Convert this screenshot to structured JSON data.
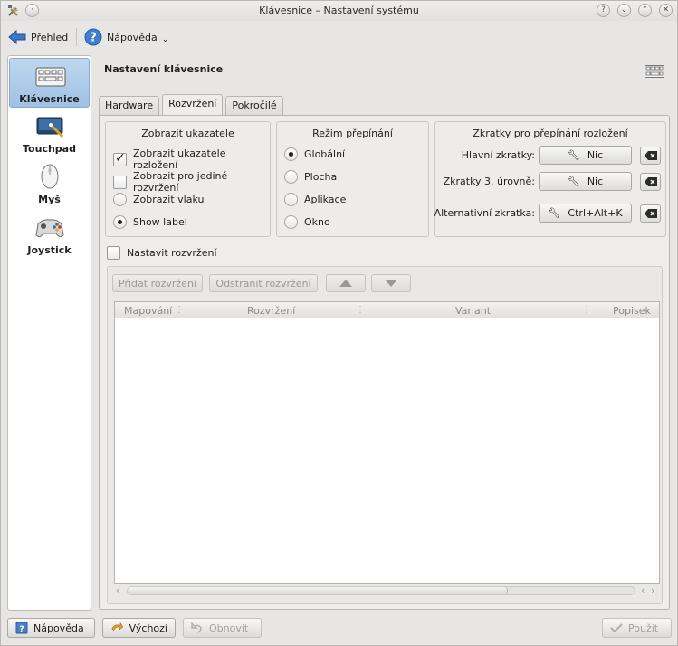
{
  "window": {
    "title": "Klávesnice – Nastavení systému",
    "button_help": "?",
    "button_min": "⌄",
    "button_max": "⌃",
    "button_close": "✕"
  },
  "toolbar": {
    "overview": "Přehled",
    "help": "Nápověda"
  },
  "sidebar": {
    "items": [
      {
        "label": "Klávesnice",
        "icon": "keyboard-icon"
      },
      {
        "label": "Touchpad",
        "icon": "touchpad-icon"
      },
      {
        "label": "Myš",
        "icon": "mouse-icon"
      },
      {
        "label": "Joystick",
        "icon": "joystick-icon"
      }
    ]
  },
  "page": {
    "title": "Nastavení klávesnice"
  },
  "tabs": [
    "Hardware",
    "Rozvržení",
    "Pokročilé"
  ],
  "indicator": {
    "title": "Zobrazit ukazatele",
    "options": [
      {
        "label": "Zobrazit ukazatele rozložení",
        "checked": true
      },
      {
        "label": "Zobrazit pro jediné rozvržení",
        "checked": false
      },
      {
        "label": "Zobrazit vlaku",
        "selected": false
      },
      {
        "label": "Show label",
        "selected": true
      }
    ]
  },
  "switch_mode": {
    "title": "Režim přepínání",
    "options": [
      {
        "label": "Globální",
        "selected": true
      },
      {
        "label": "Plocha"
      },
      {
        "label": "Aplikace"
      },
      {
        "label": "Okno"
      }
    ]
  },
  "shortcuts": {
    "title": "Zkratky pro přepínání rozložení",
    "rows": [
      {
        "label": "Hlavní zkratky:",
        "value": "Nic"
      },
      {
        "label": "Zkratky 3. úrovně:",
        "value": "Nic"
      },
      {
        "label": "Alternativní zkratka:",
        "value": "Ctrl+Alt+K"
      }
    ]
  },
  "layout": {
    "configure_label": "Nastavit rozvržení",
    "add": "Přidat rozvržení",
    "remove": "Odstranit rozvržení",
    "columns": [
      "Mapování",
      "Rozvržení",
      "Variant",
      "Popisek"
    ]
  },
  "bottom": {
    "help": "Nápověda",
    "defaults": "Výchozí",
    "reset": "Obnovit",
    "apply": "Použít"
  },
  "colors": {
    "selection": "#9fc1e4",
    "window_bg": "#e7e6e4"
  }
}
